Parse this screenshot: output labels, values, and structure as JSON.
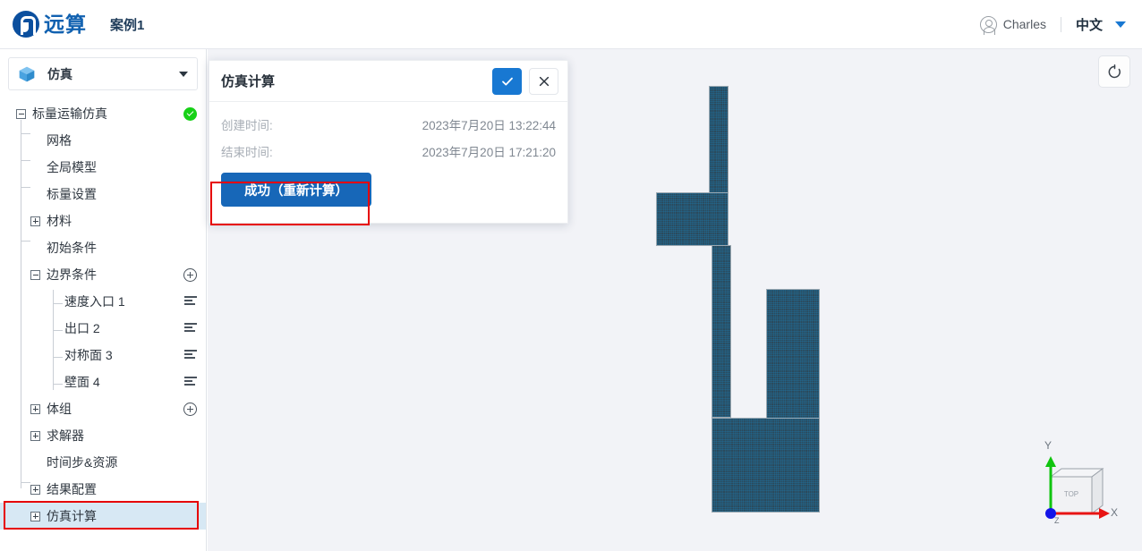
{
  "header": {
    "logo_text": "远算",
    "logo_icon": "yuansuan-logo-icon",
    "case_title": "案例1",
    "user_name": "Charles",
    "user_icon": "user-circle-icon",
    "language": "中文",
    "lang_caret_icon": "chevron-down-icon",
    "accent_color": "#1878d2",
    "brand_color": "#1161b0"
  },
  "sidebar": {
    "module": {
      "label": "仿真",
      "icon": "cube-icon",
      "caret_icon": "chevron-down-icon"
    },
    "tree": [
      {
        "label": "标量运输仿真",
        "toggle": "minus",
        "depth": 0,
        "status": "success",
        "status_icon": "check-circle-icon"
      },
      {
        "label": "网格",
        "toggle": "leaf",
        "depth": 1
      },
      {
        "label": "全局模型",
        "toggle": "leaf",
        "depth": 1
      },
      {
        "label": "标量设置",
        "toggle": "leaf",
        "depth": 1
      },
      {
        "label": "材料",
        "toggle": "plus",
        "depth": 1
      },
      {
        "label": "初始条件",
        "toggle": "leaf",
        "depth": 1
      },
      {
        "label": "边界条件",
        "toggle": "minus",
        "depth": 1,
        "action_icon": "plus-circle-icon"
      },
      {
        "label": "速度入口 1",
        "toggle": "leaf",
        "depth": 2,
        "action_icon": "list-menu-icon"
      },
      {
        "label": "出口 2",
        "toggle": "leaf",
        "depth": 2,
        "action_icon": "list-menu-icon"
      },
      {
        "label": "对称面 3",
        "toggle": "leaf",
        "depth": 2,
        "action_icon": "list-menu-icon"
      },
      {
        "label": "壁面 4",
        "toggle": "leaf",
        "depth": 2,
        "action_icon": "list-menu-icon"
      },
      {
        "label": "体组",
        "toggle": "plus",
        "depth": 1,
        "action_icon": "plus-circle-icon"
      },
      {
        "label": "求解器",
        "toggle": "plus",
        "depth": 1
      },
      {
        "label": "时间步&资源",
        "toggle": "leaf",
        "depth": 1
      },
      {
        "label": "结果配置",
        "toggle": "plus",
        "depth": 1
      },
      {
        "label": "仿真计算",
        "toggle": "plus",
        "depth": 1,
        "selected": true,
        "highlighted": true
      }
    ]
  },
  "dialog": {
    "title": "仿真计算",
    "confirm_icon": "check-icon",
    "close_icon": "close-icon",
    "fields": [
      {
        "label": "创建时间:",
        "value": "2023年7月20日 13:22:44"
      },
      {
        "label": "结束时间:",
        "value": "2023年7月20日 17:21:20"
      }
    ],
    "action_button": {
      "label": "成功（重新计算）",
      "highlighted": true,
      "color": "#1767b8"
    }
  },
  "viewport": {
    "reset_button_icon": "reset-rotate-icon",
    "background_color": "#f2f3f7",
    "mesh_color": "#2b4a5c",
    "gizmo": {
      "face_label": "TOP",
      "axis_x_label": "X",
      "axis_y_label": "Y",
      "axis_z_label": "Z",
      "axis_x_color": "#e81414",
      "axis_y_color": "#10c40f",
      "axis_z_color": "#1414e8"
    }
  },
  "annotations": {
    "highlight_color": "#e60000"
  }
}
